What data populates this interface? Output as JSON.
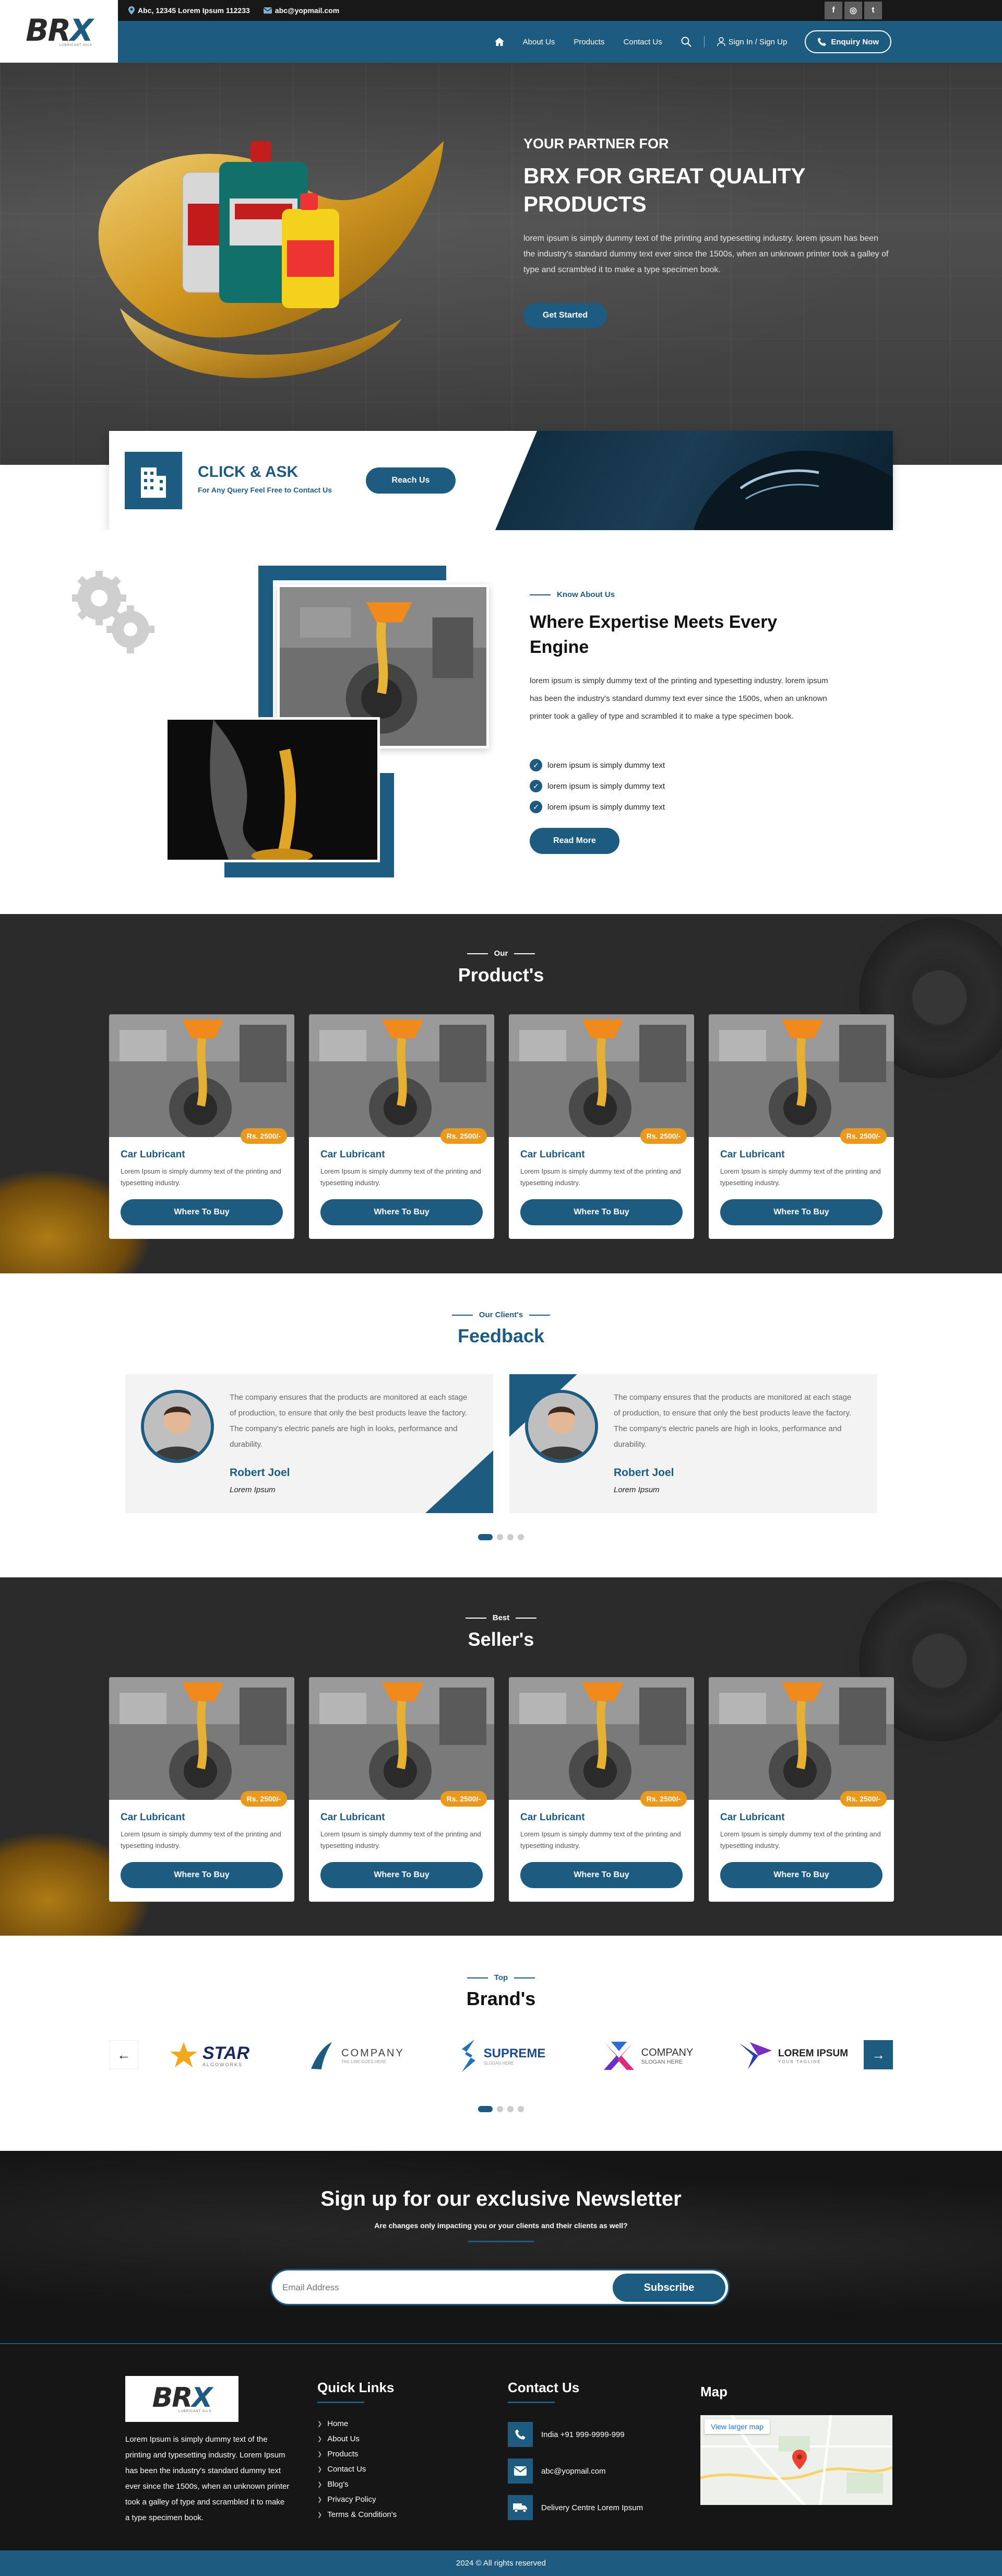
{
  "topbar": {
    "address": "Abc, 12345 Lorem Ipsum 112233",
    "email": "abc@yopmail.com",
    "social": [
      {
        "icon": "facebook-icon",
        "label": "f"
      },
      {
        "icon": "instagram-icon",
        "label": "◎"
      },
      {
        "icon": "twitter-icon",
        "label": "t"
      }
    ]
  },
  "brand": {
    "logo_text_a": "BR",
    "logo_text_b": "X",
    "logo_tag": "LUBRICANT OILS"
  },
  "nav": {
    "home_icon": "home-icon",
    "items": [
      "About Us",
      "Products",
      "Contact Us"
    ],
    "search_icon": "search-icon",
    "sign_in": "Sign In / Sign Up",
    "enquiry": "Enquiry Now"
  },
  "hero": {
    "subtitle": "YOUR PARTNER FOR",
    "title": "BRX FOR GREAT QUALITY PRODUCTS",
    "description": "lorem ipsum is simply dummy text of the printing and typesetting industry. lorem ipsum has been the industry's standard dummy text ever since the 1500s, when an unknown printer took a galley of type and scrambled it to make a type specimen book.",
    "cta": "Get Started"
  },
  "ask": {
    "title": "CLICK & ASK",
    "subtitle": "For Any Query Feel Free to Contact Us",
    "button": "Reach Us"
  },
  "about": {
    "kicker": "Know About Us",
    "title": "Where Expertise Meets Every Engine",
    "description": "lorem ipsum is simply dummy text of the printing and typesetting industry. lorem ipsum has been the industry's standard dummy text ever since the 1500s, when an unknown printer took a galley of type and scrambled it to make a type specimen book.",
    "points": [
      "lorem ipsum is simply dummy text",
      "lorem ipsum is simply dummy text",
      "lorem ipsum is simply dummy text"
    ],
    "button": "Read More"
  },
  "products": {
    "kicker": "Our",
    "title": "Product's",
    "items": [
      {
        "name": "Car Lubricant",
        "price": "Rs. 2500/-",
        "desc": "Lorem Ipsum is simply dummy text of the printing and typesetting industry.",
        "button": "Where To Buy"
      },
      {
        "name": "Car Lubricant",
        "price": "Rs. 2500/-",
        "desc": "Lorem Ipsum is simply dummy text of the printing and typesetting industry.",
        "button": "Where To Buy"
      },
      {
        "name": "Car Lubricant",
        "price": "Rs. 2500/-",
        "desc": "Lorem Ipsum is simply dummy text of the printing and typesetting industry.",
        "button": "Where To Buy"
      },
      {
        "name": "Car Lubricant",
        "price": "Rs. 2500/-",
        "desc": "Lorem Ipsum is simply dummy text of the printing and typesetting industry.",
        "button": "Where To Buy"
      }
    ]
  },
  "feedback": {
    "kicker": "Our Client's",
    "title": "Feedback",
    "items": [
      {
        "text": "The company ensures that the products are monitored at each stage of production, to ensure that only the best products leave the factory. The company's electric panels are high in looks, performance and durability.",
        "name": "Robert Joel",
        "role": "Lorem Ipsum"
      },
      {
        "text": "The company ensures that the products are monitored at each stage of production, to ensure that only the best products leave the factory. The company's electric panels are high in looks, performance and durability.",
        "name": "Robert Joel",
        "role": "Lorem Ipsum"
      }
    ]
  },
  "sellers": {
    "kicker": "Best",
    "title": "Seller's",
    "items": [
      {
        "name": "Car Lubricant",
        "price": "Rs. 2500/-",
        "desc": "Lorem Ipsum is simply dummy text of the printing and typesetting industry.",
        "button": "Where To Buy"
      },
      {
        "name": "Car Lubricant",
        "price": "Rs. 2500/-",
        "desc": "Lorem Ipsum is simply dummy text of the printing and typesetting industry.",
        "button": "Where To Buy"
      },
      {
        "name": "Car Lubricant",
        "price": "Rs. 2500/-",
        "desc": "Lorem Ipsum is simply dummy text of the printing and typesetting industry.",
        "button": "Where To Buy"
      },
      {
        "name": "Car Lubricant",
        "price": "Rs. 2500/-",
        "desc": "Lorem Ipsum is simply dummy text of the printing and typesetting industry.",
        "button": "Where To Buy"
      }
    ]
  },
  "brands": {
    "kicker": "Top",
    "title": "Brand's",
    "logos": [
      {
        "main": "STAR",
        "sub": "ALGOWORKS"
      },
      {
        "main": "COMPANY",
        "sub": "TAG LINE GOES HERE"
      },
      {
        "main": "SUPREME",
        "sub": "SLOGAN HERE"
      },
      {
        "main": "COMPANY",
        "sub": "SLOGAN HERE"
      },
      {
        "main": "LOREM IPSUM",
        "sub": "YOUR TAGLINE"
      }
    ],
    "prev_icon": "arrow-left-icon",
    "next_icon": "arrow-right-icon"
  },
  "newsletter": {
    "title": "Sign up for our exclusive Newsletter",
    "subtitle": "Are changes only impacting you or your clients and their clients as well?",
    "placeholder": "Email Address",
    "button": "Subscribe"
  },
  "footer": {
    "description": "Lorem Ipsum is simply dummy text of the printing and typesetting industry. Lorem Ipsum has been the industry's standard dummy text ever since the 1500s, when an unknown printer took a galley of type and scrambled it to make a type specimen book.",
    "quick_links_title": "Quick Links",
    "links": [
      "Home",
      "About Us",
      "Products",
      "Contact Us",
      "Blog's",
      "Privacy Policy",
      "Terms & Condition's"
    ],
    "contact_title": "Contact Us",
    "contacts": [
      {
        "icon": "phone-icon",
        "text": "India +91 999-9999-999"
      },
      {
        "icon": "mail-icon",
        "text": "abc@yopmail.com"
      },
      {
        "icon": "truck-icon",
        "text": "Delivery Centre Lorem Ipsum"
      }
    ],
    "map_title": "Map",
    "map_link": "View larger map",
    "copyright": "2024 © All rights reserved"
  },
  "colors": {
    "primary": "#1e5b80",
    "accent": "#e99a1c",
    "dark": "#2b2b2b"
  }
}
